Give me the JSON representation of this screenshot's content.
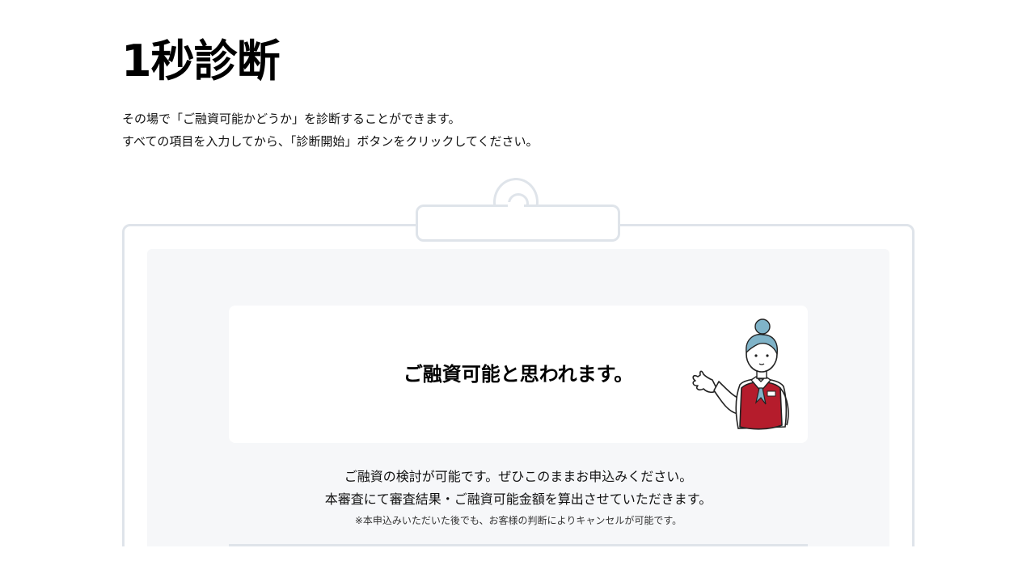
{
  "page": {
    "title": "1秒診断",
    "intro_line1": "その場で「ご融資可能かどうか」を診断することができます。",
    "intro_line2": "すべての項目を入力してから、「診断開始」ボタンをクリックしてください。"
  },
  "result": {
    "heading": "ご融資可能と思われます。",
    "message_line1": "ご融資の検討が可能です。ぜひこのままお申込みください。",
    "message_line2": "本審査にて審査結果・ご融資可能金額を算出させていただきます。",
    "note": "※本申込みいただいた後でも、お客様の判断によりキャンセルが可能です。"
  },
  "colors": {
    "board_border": "#dfe4ea",
    "board_fill": "#f6f7f9",
    "mascot_vest": "#b51c2c",
    "mascot_hair": "#7fb3c8"
  },
  "icons": {
    "mascot": "staff-woman-pointing-illustration"
  }
}
